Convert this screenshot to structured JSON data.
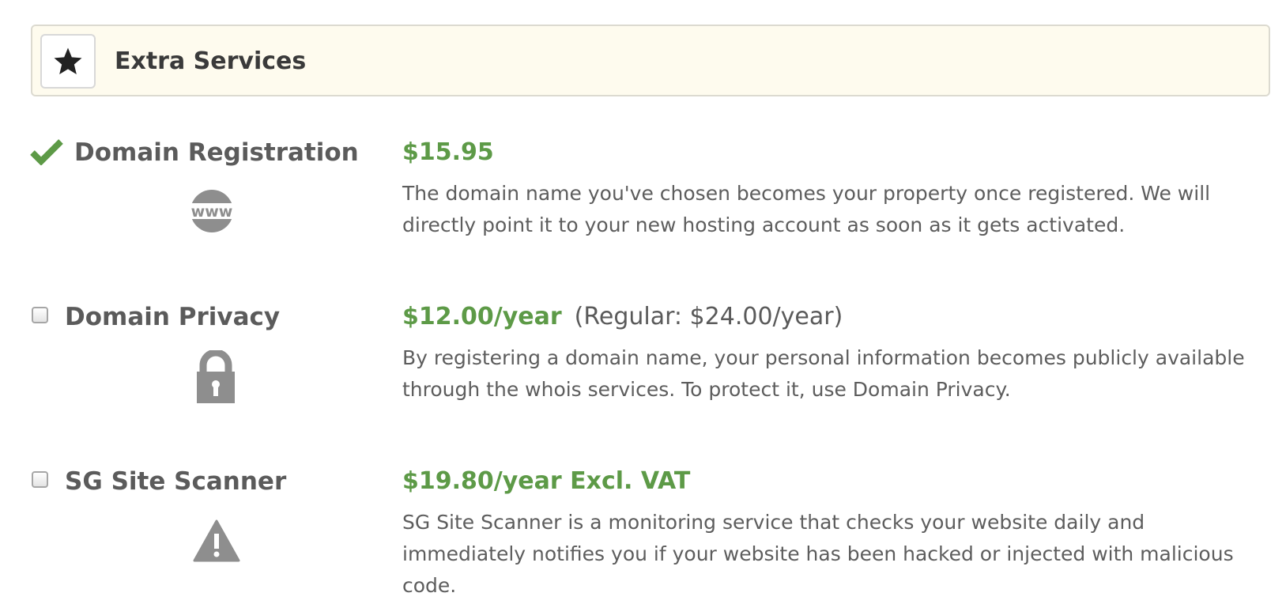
{
  "header": {
    "icon": "star-icon",
    "title": "Extra Services"
  },
  "colors": {
    "price": "#5d9a47",
    "check": "#5d9a47",
    "header_bg": "#fefbee",
    "icon_grey": "#8e8e8e"
  },
  "services": [
    {
      "name": "Domain Registration",
      "selected": true,
      "icon": "www-globe-icon",
      "price": "$15.95",
      "regular": "",
      "description": "The domain name you've chosen becomes your property once registered. We will directly point it to your new hosting account as soon as it gets activated."
    },
    {
      "name": "Domain Privacy",
      "selected": false,
      "icon": "lock-icon",
      "price": "$12.00/year",
      "regular": "(Regular: $24.00/year)",
      "description": "By registering a domain name, your personal information becomes publicly available through the whois services. To protect it, use Domain Privacy."
    },
    {
      "name": "SG Site Scanner",
      "selected": false,
      "icon": "warning-icon",
      "price": "$19.80/year Excl. VAT",
      "regular": "",
      "description": "SG Site Scanner is a monitoring service that checks your website daily and immediately notifies you if your website has been hacked or injected with malicious code."
    }
  ]
}
